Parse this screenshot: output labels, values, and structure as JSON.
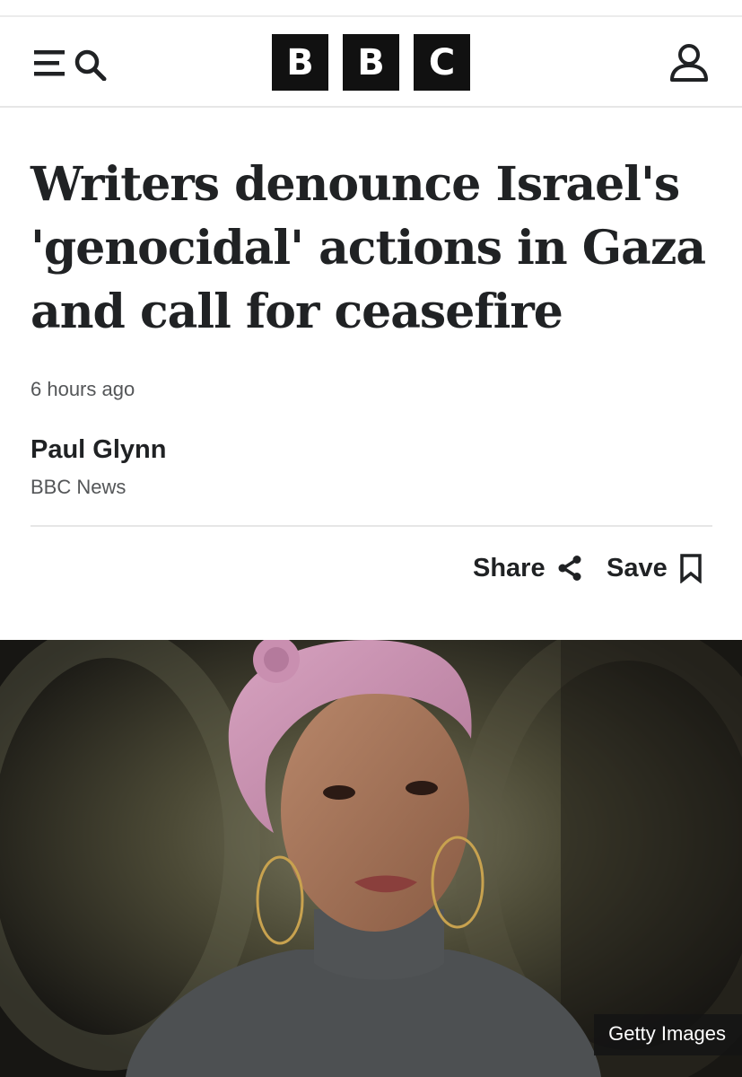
{
  "header": {
    "logo_letters": [
      "B",
      "B",
      "C"
    ],
    "menu_icon": "menu-icon",
    "search_icon": "search-icon",
    "account_icon": "account-icon"
  },
  "article": {
    "headline": "Writers denounce Israel's 'genocidal' actions in Gaza and call for ceasefire",
    "timestamp": "6 hours ago",
    "author": "Paul Glynn",
    "organization": "BBC News"
  },
  "actions": {
    "share_label": "Share",
    "share_icon": "share-icon",
    "save_label": "Save",
    "save_icon": "bookmark-icon"
  },
  "image": {
    "credit": "Getty Images"
  },
  "colors": {
    "text": "#202224",
    "secondary_text": "#545658",
    "logo_bg": "#111111",
    "divider": "#e6e6e6"
  }
}
